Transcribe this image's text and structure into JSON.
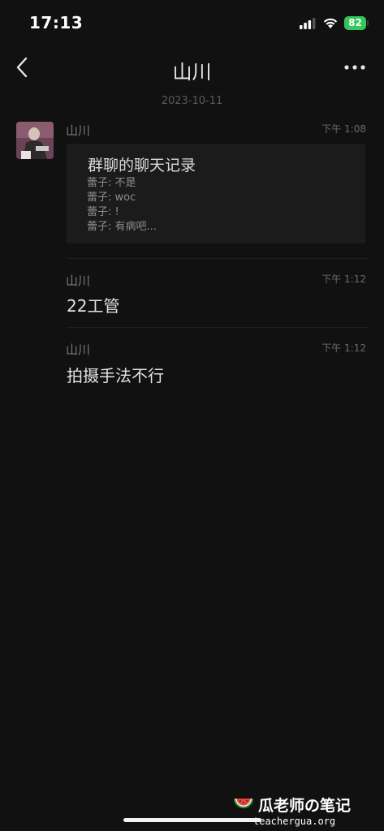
{
  "status_bar": {
    "time": "17:13",
    "battery": "82"
  },
  "nav": {
    "title": "山川",
    "back_icon": "chevron-left-icon",
    "more_icon": "ellipsis-icon"
  },
  "date_separator": "2023-10-11",
  "messages": [
    {
      "sender": "山川",
      "time": "下午 1:08",
      "type": "chat_record",
      "record": {
        "title": "群聊的聊天记录",
        "lines": [
          "蕾子: 不是",
          "蕾子: woc",
          "蕾子: !",
          "蕾子: 有病吧..."
        ]
      }
    },
    {
      "sender": "山川",
      "time": "下午 1:12",
      "type": "text",
      "text": "22工管"
    },
    {
      "sender": "山川",
      "time": "下午 1:12",
      "type": "text",
      "text": "拍摄手法不行"
    }
  ],
  "watermark": {
    "title": "瓜老师の笔记",
    "url": "teachergua.org"
  },
  "colors": {
    "background": "#111111",
    "card": "#1b1b1b",
    "battery": "#34c759"
  }
}
